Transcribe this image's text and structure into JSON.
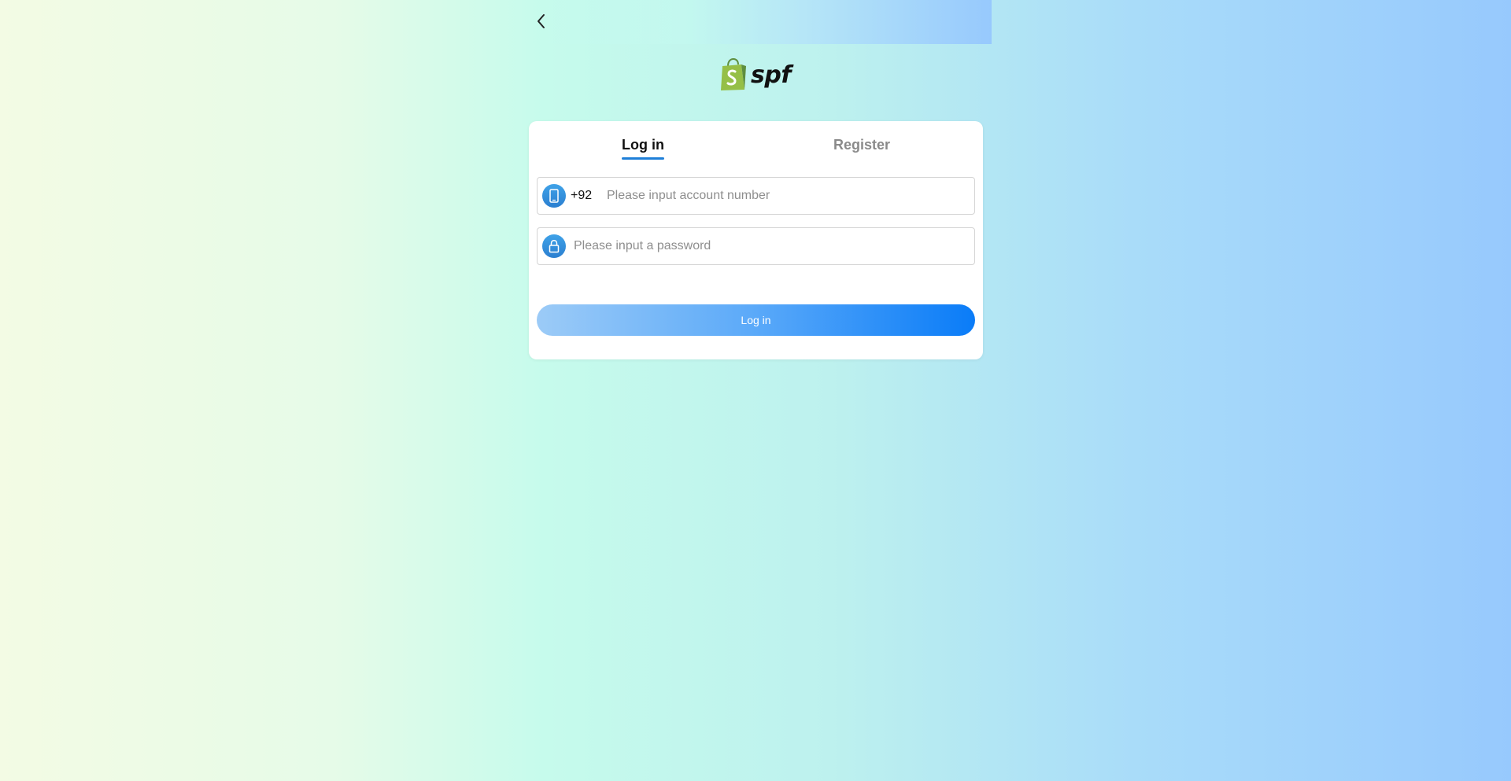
{
  "colors": {
    "accent": "#1e7fd8",
    "button_gradient_start": "#9ccbf7",
    "button_gradient_end": "#0a7cf8",
    "logo_bag": "#8fbf3a"
  },
  "header": {
    "back_icon": "chevron-left-icon"
  },
  "logo": {
    "icon": "shopping-bag-icon",
    "text": "spf"
  },
  "tabs": [
    {
      "label": "Log in",
      "active": true
    },
    {
      "label": "Register",
      "active": false
    }
  ],
  "form": {
    "account": {
      "icon": "phone-icon",
      "country_code": "+92",
      "placeholder": "Please input account number",
      "value": ""
    },
    "password": {
      "icon": "lock-icon",
      "placeholder": "Please input a password",
      "value": ""
    },
    "submit_label": "Log in"
  }
}
